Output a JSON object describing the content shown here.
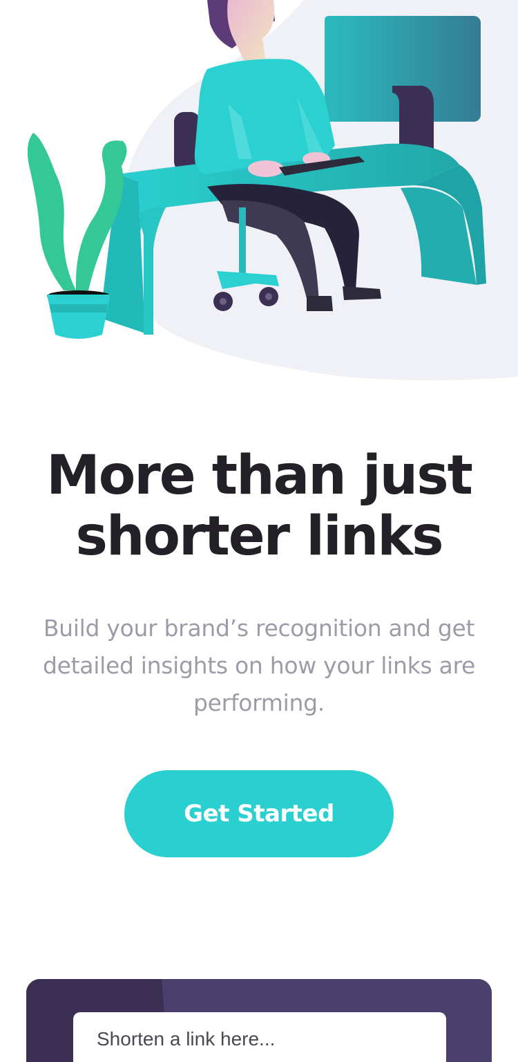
{
  "hero": {
    "illustration": "person-working-at-desk-illustration",
    "title_line1": "More than just",
    "title_line2": "shorter links",
    "subtitle": "Build your brand’s recognition and get detailed insights on how your links are performing.",
    "cta_label": "Get Started"
  },
  "shorten": {
    "placeholder": "Shorten a link here...",
    "value": ""
  },
  "colors": {
    "cyan": "#2acfcf",
    "dark_violet": "#3b3054",
    "panel_violet": "#4b3f6b",
    "heading": "#232127",
    "grayish_violet": "#9e9aa7",
    "illustration_bg": "#f0f1f6",
    "plant_green": "#35c897"
  }
}
